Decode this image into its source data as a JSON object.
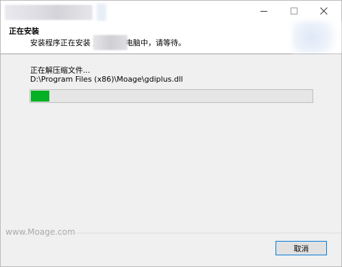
{
  "window": {
    "controls": {
      "minimize_icon": "minimize-icon",
      "maximize_icon": "maximize-icon",
      "close_icon": "close-icon"
    }
  },
  "header": {
    "heading": "正在安装",
    "subtitle": "安装程序正在安装          王 到您的电脑中，请等待。"
  },
  "main": {
    "status_label": "正在解压缩文件...",
    "file_path": "D:\\Program Files (x86)\\Moage\\gdiplus.dll",
    "progress_percent": 7,
    "progress_color": "#06b025"
  },
  "footer": {
    "watermark": "www.Moage.com",
    "cancel_label": "取消"
  }
}
